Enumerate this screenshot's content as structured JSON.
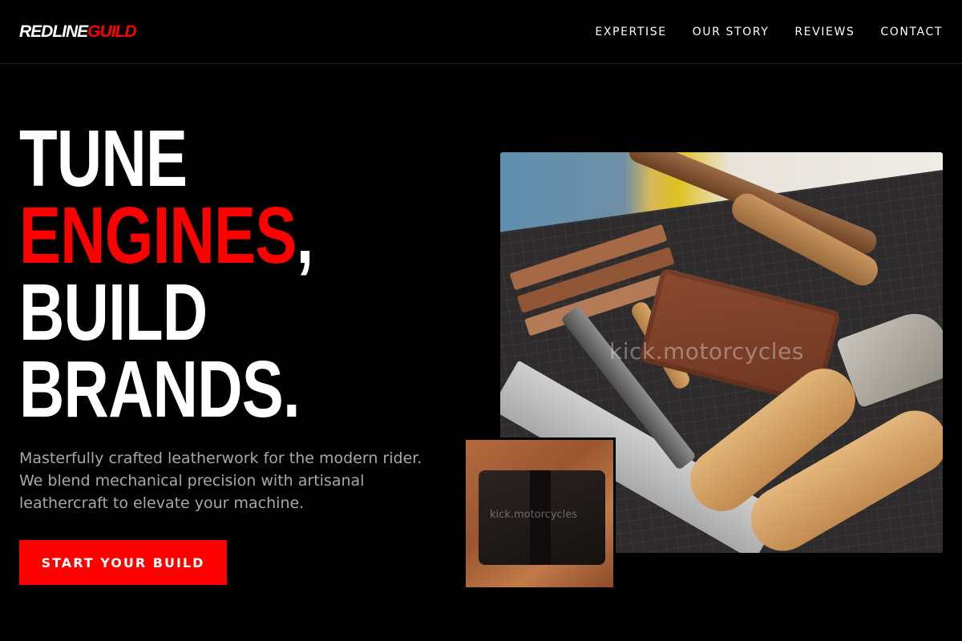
{
  "header": {
    "logo_part1": "REDLINE",
    "logo_part2": "GUILD",
    "nav": [
      "EXPERTISE",
      "OUR STORY",
      "REVIEWS",
      "CONTACT"
    ]
  },
  "hero": {
    "line1": "TUNE",
    "line2_red": "ENGINES",
    "line2_suffix": ",",
    "line3": "BUILD",
    "line4": "BRANDS.",
    "tagline": "Masterfully crafted leatherwork for the modern rider. We blend mechanical precision with artisanal leathercraft to elevate your machine.",
    "cta_label": "START YOUR BUILD"
  },
  "images": {
    "main_watermark": "kick.motorcycles",
    "small_watermark": "kick.motorcycles"
  },
  "colors": {
    "accent": "#ff0000",
    "background": "#000000",
    "text": "#ffffff",
    "muted": "#a8a8a8"
  }
}
